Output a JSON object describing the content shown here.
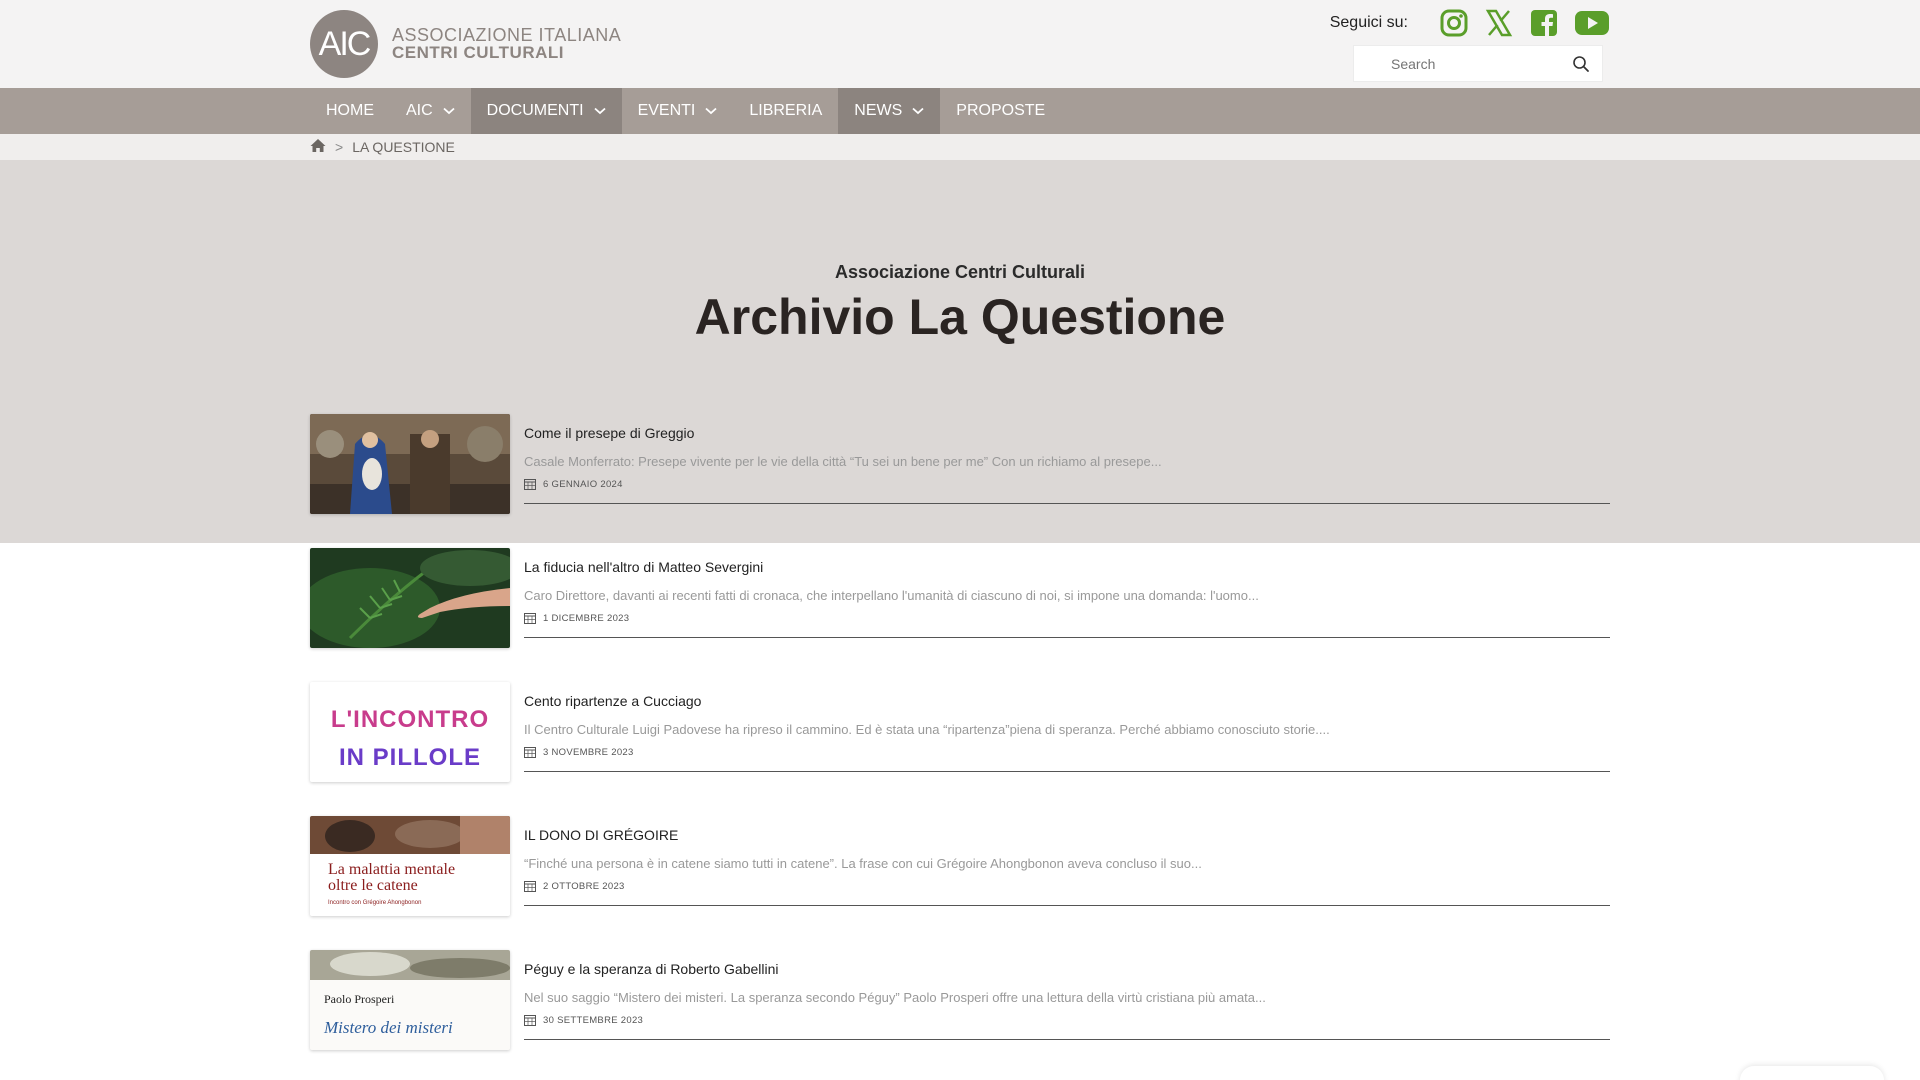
{
  "header": {
    "logo_initials": "AIC",
    "logo_line1": "ASSOCIAZIONE ITALIANA",
    "logo_line2": "CENTRI CULTURALI",
    "social_label": "Seguici su:",
    "social_icons": [
      "instagram-icon",
      "x-icon",
      "facebook-icon",
      "youtube-icon"
    ],
    "social_color": "#5a9e2a",
    "search_placeholder": "Search"
  },
  "nav": {
    "items": [
      {
        "label": "Home",
        "dropdown": false,
        "active": false
      },
      {
        "label": "AIC",
        "dropdown": true,
        "active": false
      },
      {
        "label": "Documenti",
        "dropdown": true,
        "active": true
      },
      {
        "label": "Eventi",
        "dropdown": true,
        "active": false
      },
      {
        "label": "Libreria",
        "dropdown": false,
        "active": false
      },
      {
        "label": "News",
        "dropdown": true,
        "active": true
      },
      {
        "label": "Proposte",
        "dropdown": false,
        "active": false
      }
    ]
  },
  "breadcrumb": {
    "home_icon": "home-icon",
    "separator": ">",
    "current": "LA QUESTIONE"
  },
  "hero": {
    "subtitle": "Associazione Centri Culturali",
    "title": "Archivio La Questione"
  },
  "articles": [
    {
      "title": "Come il presepe di Greggio",
      "excerpt": "Casale Monferrato: Presepe vivente per le vie della città “Tu sei un bene per me” Con un richiamo al presepe...",
      "date": "6 GENNAIO 2024"
    },
    {
      "title": "La fiducia nell'altro di Matteo Severgini",
      "excerpt": "Caro Direttore, davanti ai recenti fatti di cronaca, che interpellano l'umanità di ciascuno di noi, si impone una domanda: l'uomo...",
      "date": "1 DICEMBRE 2023"
    },
    {
      "title": "Cento ripartenze a Cucciago",
      "excerpt": "Il Centro Culturale Luigi Padovese ha ripreso il cammino. Ed è stata una “ripartenza”piena di speranza. Perché abbiamo conosciuto storie....",
      "date": "3 NOVEMBRE 2023",
      "thumb_text1": "L'INCONTRO",
      "thumb_text2": "IN PILLOLE"
    },
    {
      "title": "IL DONO DI GRÉGOIRE",
      "excerpt": "“Finché una persona è in catene siamo tutti in catene”. La frase con cui Grégoire Ahongbonon aveva concluso il suo...",
      "date": "2 OTTOBRE 2023",
      "thumb_text1": "La malattia mentale",
      "thumb_text2": "oltre le catene",
      "thumb_text3": "Incontro con Grégoire Ahongbonon"
    },
    {
      "title": "Péguy e la speranza di Roberto Gabellini",
      "excerpt": "Nel suo saggio “Mistero dei misteri. La speranza secondo Péguy” Paolo Prosperi offre una lettura della virtù cristiana più amata...",
      "date": "30 SETTEMBRE 2023",
      "thumb_text1": "Paolo Prosperi",
      "thumb_text2": "Mistero dei misteri"
    }
  ]
}
